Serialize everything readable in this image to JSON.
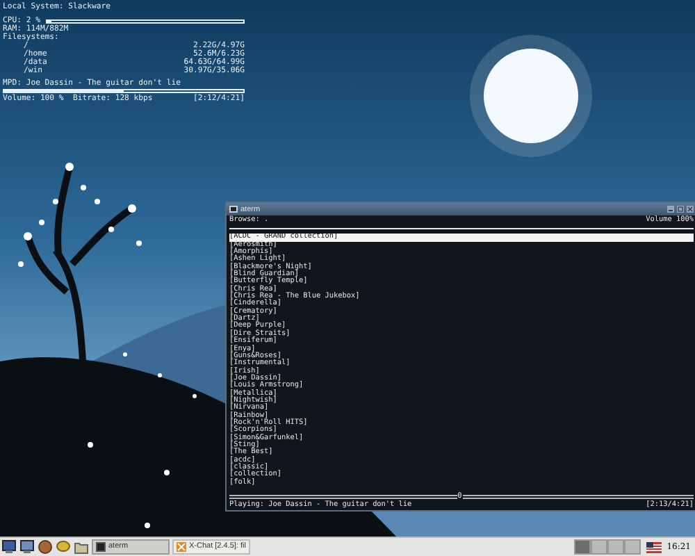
{
  "conky": {
    "title": "Local System: Slackware",
    "cpu": {
      "label": "CPU: 2 %",
      "level": 0.02
    },
    "ram": "RAM: 114M/882M",
    "filesystems_label": "Filesystems:",
    "filesystems": [
      {
        "mount": "/",
        "usage": "2.22G/4.97G"
      },
      {
        "mount": "/home",
        "usage": "52.6M/6.23G"
      },
      {
        "mount": "/data",
        "usage": "64.63G/64.99G"
      },
      {
        "mount": "/win",
        "usage": "30.97G/35.06G"
      }
    ],
    "mpd": {
      "label": "MPD: Joe Dassin - The guitar don't lie",
      "level": 0.5
    },
    "status": "Volume: 100 %  Bitrate: 128 kbps",
    "time": "[2:12/4:21]"
  },
  "terminal": {
    "title": "aterm",
    "browse": "Browse: .",
    "volume": "Volume 100%",
    "items": [
      {
        "label": "[ACDC - GRAND collection]",
        "selected": true
      },
      {
        "label": "[Aerosmith]",
        "selected": false
      },
      {
        "label": "[Amorphis]",
        "selected": false
      },
      {
        "label": "[Ashen Light]",
        "selected": false
      },
      {
        "label": "[Blackmore's Night]",
        "selected": false
      },
      {
        "label": "[Blind Guardian]",
        "selected": false
      },
      {
        "label": "[Butterfly Temple]",
        "selected": false
      },
      {
        "label": "[Chris Rea]",
        "selected": false
      },
      {
        "label": "[Chris Rea - The Blue Jukebox]",
        "selected": false
      },
      {
        "label": "[Cinderella]",
        "selected": false
      },
      {
        "label": "[Crematory]",
        "selected": false
      },
      {
        "label": "[Dartz]",
        "selected": false
      },
      {
        "label": "[Deep Purple]",
        "selected": false
      },
      {
        "label": "[Dire Straits]",
        "selected": false
      },
      {
        "label": "[Ensiferum]",
        "selected": false
      },
      {
        "label": "[Enya]",
        "selected": false
      },
      {
        "label": "[Guns&Roses]",
        "selected": false
      },
      {
        "label": "[Instrumental]",
        "selected": false
      },
      {
        "label": "[Irish]",
        "selected": false
      },
      {
        "label": "[Joe Dassin]",
        "selected": false
      },
      {
        "label": "[Louis Armstrong]",
        "selected": false
      },
      {
        "label": "[Metallica]",
        "selected": false
      },
      {
        "label": "[Nightwish]",
        "selected": false
      },
      {
        "label": "[Nirvana]",
        "selected": false
      },
      {
        "label": "[Rainbow]",
        "selected": false
      },
      {
        "label": "[Rock'n'Roll HITS]",
        "selected": false
      },
      {
        "label": "[Scorpions]",
        "selected": false
      },
      {
        "label": "[Simon&Garfunkel]",
        "selected": false
      },
      {
        "label": "[Sting]",
        "selected": false
      },
      {
        "label": "[The Best]",
        "selected": false
      },
      {
        "label": "[acdc]",
        "selected": false
      },
      {
        "label": "[classic]",
        "selected": false
      },
      {
        "label": "[collection]",
        "selected": false
      },
      {
        "label": "[folk]",
        "selected": false
      }
    ],
    "progress": {
      "marker": "0",
      "level": 0.49
    },
    "now_playing": "Playing: Joe Dassin - The guitar don't lie",
    "time": "[2:13/4:21]"
  },
  "taskbar": {
    "tasks": [
      {
        "label": "aterm",
        "selected": true
      },
      {
        "label": "X-Chat [2.4.5]: fil",
        "selected": false
      }
    ],
    "pager": [
      {
        "selected": true
      },
      {
        "selected": false
      },
      {
        "selected": false
      },
      {
        "selected": false
      }
    ],
    "clock": "16:21"
  }
}
